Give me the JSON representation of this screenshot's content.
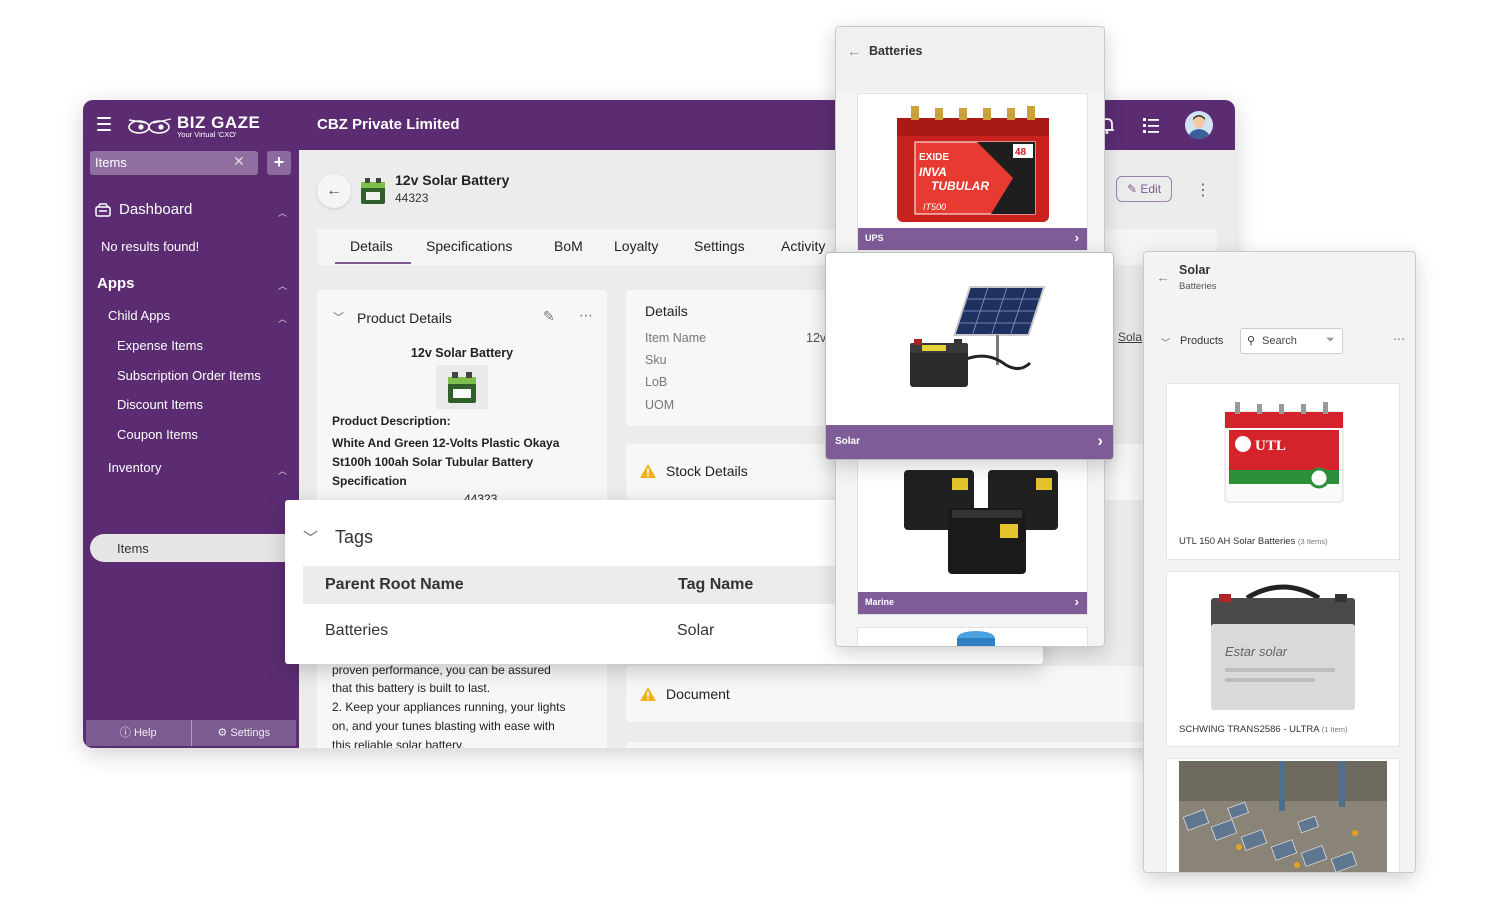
{
  "topbar": {
    "brand_name": "BIZ GAZE",
    "brand_tagline": "Your Virtual 'CXO'",
    "company": "CBZ Private Limited",
    "icons": [
      "menu-icon",
      "bell-icon",
      "list-icon",
      "avatar"
    ]
  },
  "sidebar": {
    "search_value": "Items",
    "add_label": "+",
    "dashboard": "Dashboard",
    "no_results": "No results found!",
    "apps": "Apps",
    "child_apps": "Child Apps",
    "items": [
      "Expense Items",
      "Subscription Order Items",
      "Discount Items",
      "Coupon Items"
    ],
    "inventory": "Inventory",
    "active_item": "Items",
    "help": "Help",
    "settings": "Settings"
  },
  "header": {
    "title": "12v Solar Battery",
    "code": "44323",
    "edit": "Edit"
  },
  "tabs": [
    "Details",
    "Specifications",
    "BoM",
    "Loyalty",
    "Settings",
    "Activity"
  ],
  "product_details": {
    "title": "Product Details",
    "name": "12v Solar Battery",
    "desc_label": "Product Description:",
    "desc_lines": [
      "White And Green 12-Volts Plastic Okaya",
      "St100h 100ah Solar Tubular Battery",
      "Specification"
    ],
    "sku_fragment": "44323",
    "more_lines": [
      "proven performance, you can be assured",
      "that this battery is built to last.",
      "2. Keep your appliances running, your lights",
      "on, and your tunes blasting with ease with",
      "this reliable solar battery."
    ]
  },
  "details": {
    "title": "Details",
    "fields": [
      "Item Name",
      "Sku",
      "LoB",
      "UOM"
    ],
    "item_name_fragment": "12v",
    "side_fragment": "Sola"
  },
  "stock": {
    "title": "Stock Details"
  },
  "document": {
    "title": "Document"
  },
  "tags": {
    "title": "Tags",
    "columns": [
      "Parent Root Name",
      "Tag Name"
    ],
    "rows": [
      [
        "Batteries",
        "Solar"
      ]
    ]
  },
  "batteries_panel": {
    "title": "Batteries",
    "tiles": [
      "UPS",
      "Solar",
      "Marine"
    ],
    "exide_brand": "EXIDE",
    "exide_line1": "INVA",
    "exide_line2": "TUBULAR",
    "exide_capacity": "48",
    "exide_model": "IT500"
  },
  "solar_panel": {
    "title": "Solar",
    "subtitle": "Batteries",
    "products_label": "Products",
    "search_placeholder": "Search",
    "products": [
      {
        "name": "UTL 150 AH Solar Batteries",
        "count": "(3 Items)"
      },
      {
        "name": "SCHWING TRANS2586 - ULTRA",
        "count": "(1 Item)"
      }
    ],
    "utl_brand": "UTL",
    "estar_brand": "Estar solar"
  },
  "colors": {
    "brand": "#5b2c72",
    "accent": "#7e5c98",
    "warning": "#f2b01e"
  }
}
